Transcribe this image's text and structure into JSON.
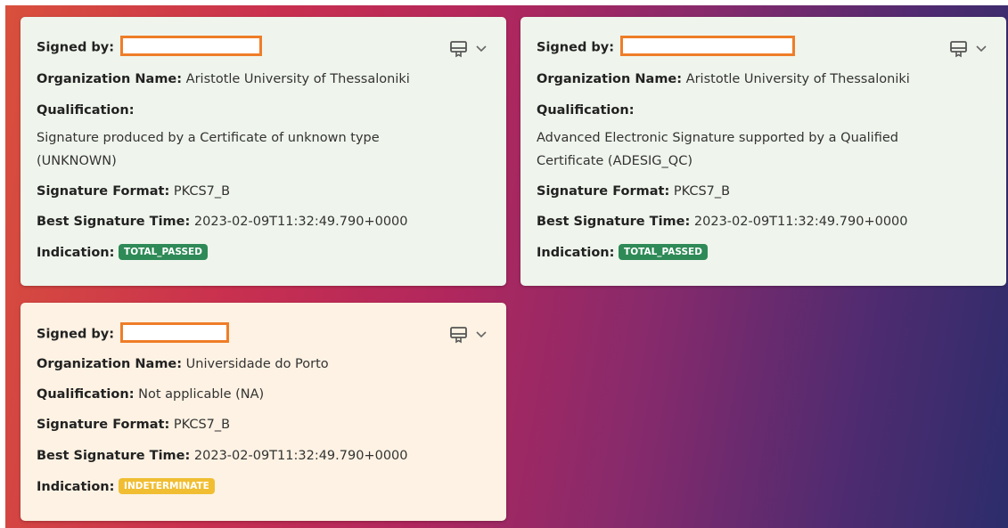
{
  "cards": [
    {
      "signed_by_label": "Signed by:",
      "organization_label": "Organization Name:",
      "organization_value": "Aristotle University of Thessaloniki",
      "qualification_label": "Qualification:",
      "qualification_value": "Signature produced by a Certificate of unknown type (UNKNOWN)",
      "format_label": "Signature Format:",
      "format_value": "PKCS7_B",
      "time_label": "Best Signature Time:",
      "time_value": "2023-02-09T11:32:49.790+0000",
      "indication_label": "Indication:",
      "indication_value": "TOTAL_PASSED",
      "indication_color": "#2e8a56",
      "card_color": "#eff5ec"
    },
    {
      "signed_by_label": "Signed by:",
      "organization_label": "Organization Name:",
      "organization_value": "Aristotle University of Thessaloniki",
      "qualification_label": "Qualification:",
      "qualification_value": "Advanced Electronic Signature supported by a Qualified Certificate (ADESIG_QC)",
      "format_label": "Signature Format:",
      "format_value": "PKCS7_B",
      "time_label": "Best Signature Time:",
      "time_value": "2023-02-09T11:32:49.790+0000",
      "indication_label": "Indication:",
      "indication_value": "TOTAL_PASSED",
      "indication_color": "#2e8a56",
      "card_color": "#eff5ec"
    },
    {
      "signed_by_label": "Signed by:",
      "organization_label": "Organization Name:",
      "organization_value": "Universidade do Porto",
      "qualification_label": "Qualification:",
      "qualification_value": "Not applicable (NA)",
      "format_label": "Signature Format:",
      "format_value": "PKCS7_B",
      "time_label": "Best Signature Time:",
      "time_value": "2023-02-09T11:32:49.790+0000",
      "indication_label": "Indication:",
      "indication_value": "INDETERMINATE",
      "indication_color": "#f1be32",
      "card_color": "#fdf2e3"
    }
  ],
  "icons": {
    "certificate": "certificate-icon",
    "expand": "chevron-down-icon"
  },
  "colors": {
    "redaction_border": "#ef7d28"
  }
}
